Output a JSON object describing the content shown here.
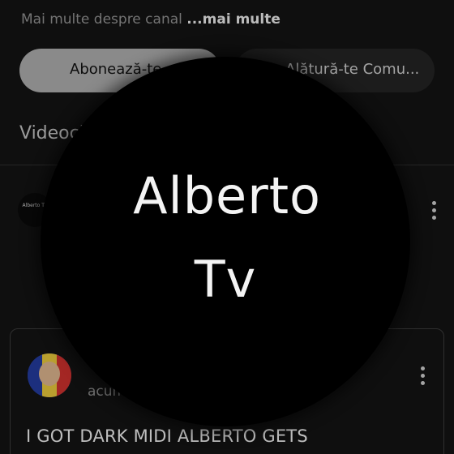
{
  "channel": {
    "more_about_text": "Mai multe despre canal",
    "more_link": "...mai multe",
    "subscribe_label": "Abonează-te",
    "join_label": "Alătură-te Comu...",
    "videos_heading": "Videoclipuri"
  },
  "feed": {
    "small_avatar_text": "Alberto Tv",
    "card": {
      "meta_text": "acum",
      "title": "I GOT DARK MIDI ALBERTO GETS"
    }
  },
  "overlay": {
    "line1": "Alberto",
    "line2": "Tv"
  },
  "colors": {
    "background": "#131313",
    "subscribe_button": "#a9a9a9",
    "join_button": "#232323",
    "overlay_circle": "#000000"
  },
  "icons": {
    "kebab": "more-vert-icon"
  }
}
